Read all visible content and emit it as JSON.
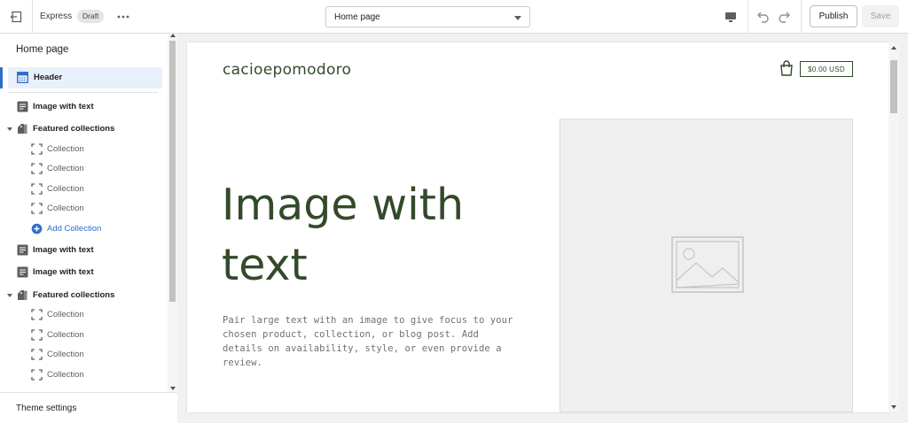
{
  "topbar": {
    "theme_name": "Express",
    "status_badge": "Draft",
    "page_select": "Home page",
    "publish_label": "Publish",
    "save_label": "Save"
  },
  "sidebar": {
    "title": "Home page",
    "items": [
      {
        "label": "Header",
        "icon": "header-icon",
        "level": 1,
        "selected": true
      },
      {
        "label": "Image with text",
        "icon": "text-block-icon",
        "level": 1
      },
      {
        "label": "Featured collections",
        "icon": "collection-tag-icon",
        "level": 1,
        "expanded": true
      },
      {
        "label": "Collection",
        "icon": "dashed-square-icon",
        "level": 2
      },
      {
        "label": "Collection",
        "icon": "dashed-square-icon",
        "level": 2
      },
      {
        "label": "Collection",
        "icon": "dashed-square-icon",
        "level": 2
      },
      {
        "label": "Collection",
        "icon": "dashed-square-icon",
        "level": 2
      },
      {
        "label": "Add Collection",
        "icon": "add-circle-icon",
        "level": 2
      },
      {
        "label": "Image with text",
        "icon": "text-block-icon",
        "level": 1
      },
      {
        "label": "Image with text",
        "icon": "text-block-icon",
        "level": 1
      },
      {
        "label": "Featured collections",
        "icon": "collection-tag-icon",
        "level": 1,
        "expanded": true
      },
      {
        "label": "Collection",
        "icon": "dashed-square-icon",
        "level": 2
      },
      {
        "label": "Collection",
        "icon": "dashed-square-icon",
        "level": 2
      },
      {
        "label": "Collection",
        "icon": "dashed-square-icon",
        "level": 2
      },
      {
        "label": "Collection",
        "icon": "dashed-square-icon",
        "level": 2
      }
    ],
    "theme_settings": "Theme settings"
  },
  "preview": {
    "store_name": "cacioepomodoro",
    "cart_total": "$0.00 USD",
    "hero_heading": "Image with text",
    "hero_body": "Pair large text with an image to give focus to your chosen product, collection, or blog post. Add details on availability, style, or even provide a review."
  },
  "colors": {
    "accent": "#2c6ecb",
    "brand_green": "#334a2a",
    "selected_bg": "#e8f0fb"
  }
}
